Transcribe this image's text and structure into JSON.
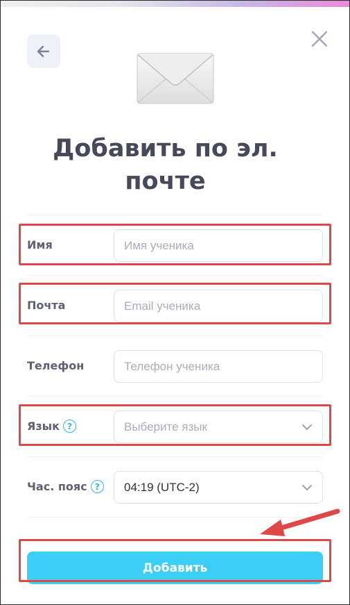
{
  "dialog": {
    "title": "Добавить по эл. почте"
  },
  "icons": {
    "back": "arrow-left-icon",
    "close": "close-icon",
    "envelope": "envelope-icon",
    "help": "question-circle-icon",
    "dropdown": "chevron-down-icon"
  },
  "form": {
    "name": {
      "label": "Имя",
      "placeholder": "Имя ученика"
    },
    "email": {
      "label": "Почта",
      "placeholder": "Email ученика"
    },
    "phone": {
      "label": "Телефон",
      "placeholder": "Телефон ученика"
    },
    "language": {
      "label": "Язык",
      "help": "?",
      "placeholder": "Выберите язык"
    },
    "timezone": {
      "label": "Час. пояс",
      "help": "?",
      "value": "04:19 (UTC-2)"
    },
    "submit_label": "Добавить"
  },
  "colors": {
    "accent": "#3ccff6",
    "highlight": "#e04848",
    "title": "#474859",
    "help_icon": "#2fb6e4"
  }
}
